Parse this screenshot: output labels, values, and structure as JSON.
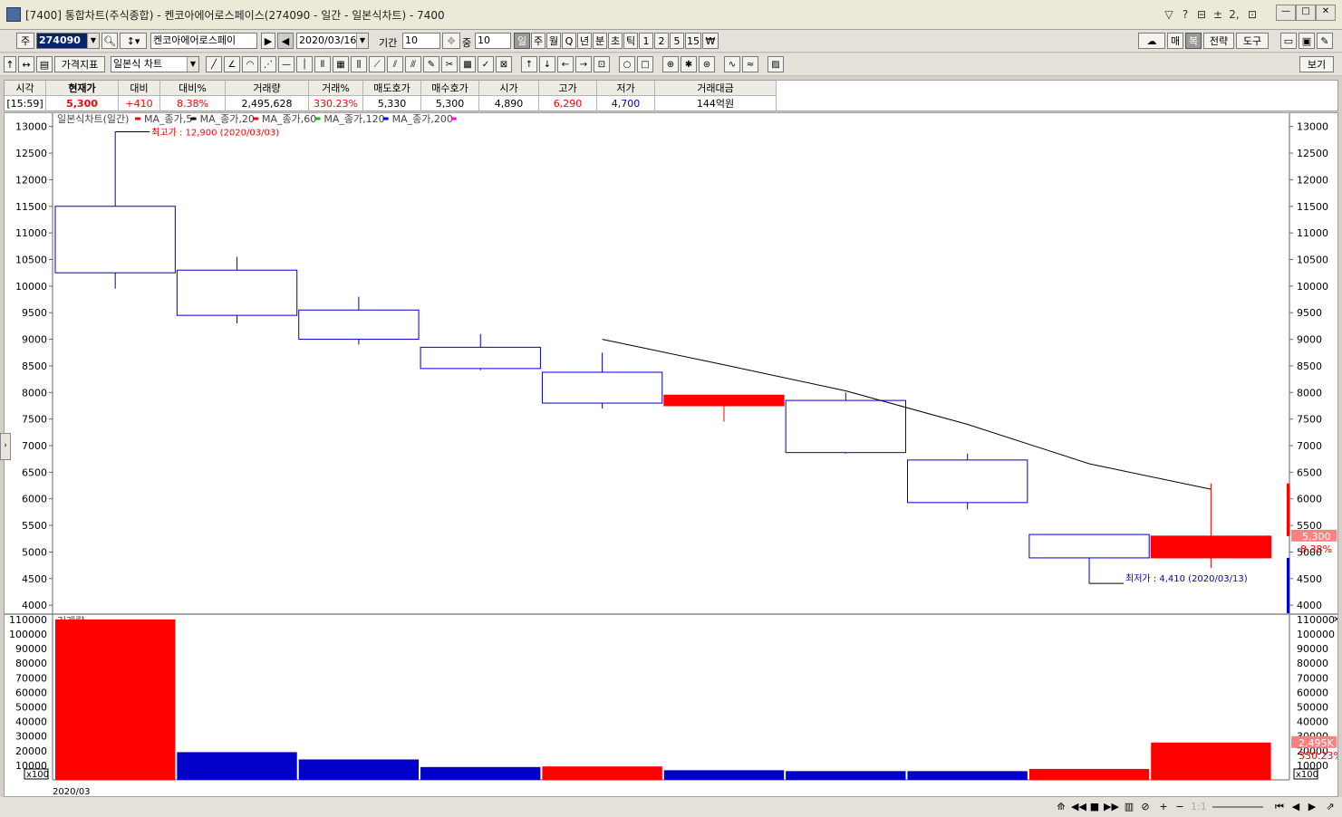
{
  "window": {
    "title": "[7400] 통합차트(주식종합) - 켄코아에어로스페이스(274090 - 일간 - 일본식차트) - 7400",
    "toolbar_icons": [
      "message-icon",
      "help-icon",
      "window-icon",
      "pin-icon",
      "dual-window-icon",
      "settings-icon"
    ],
    "help_label": "?",
    "dual_label": "2,"
  },
  "toolbar1": {
    "market_type": "주",
    "code": "274090",
    "stock_name": "켄코아에어로스페이",
    "date": "2020/03/16",
    "period_label": "기간",
    "period_value": "10",
    "overlap_label": "중",
    "overlap_value": "10",
    "timeframes": [
      "일",
      "주",
      "월",
      "Q",
      "년",
      "분",
      "초",
      "틱",
      "1",
      "2",
      "5",
      "15",
      "₩"
    ],
    "active_timeframe": 0,
    "right_buttons": [
      "매",
      "복",
      "전략",
      "도구"
    ]
  },
  "toolbar2": {
    "indicator_button": "가격지표",
    "chart_type": "일본식 차트",
    "view_button": "보기"
  },
  "quote": {
    "headers": [
      "시각",
      "현재가",
      "대비",
      "대비%",
      "거래량",
      "거래%",
      "매도호가",
      "매수호가",
      "시가",
      "고가",
      "저가",
      "거래대금"
    ],
    "values": [
      "[15:59]",
      "5,300",
      "+410",
      "8.38%",
      "2,495,628",
      "330.23%",
      "5,330",
      "5,300",
      "4,890",
      "6,290",
      "4,700",
      "144억원"
    ]
  },
  "chart_data": {
    "type": "candlestick",
    "legend": {
      "title": "일본식차트(일간)",
      "series": [
        {
          "name": "MA_종가,5",
          "color": "#ff0000"
        },
        {
          "name": "MA_종가,20",
          "color": "#000000"
        },
        {
          "name": "MA_종가,60",
          "color": "#ff0000"
        },
        {
          "name": "MA_종가,120",
          "color": "#00c000"
        },
        {
          "name": "MA_종가,200",
          "color": "#0000ff"
        }
      ],
      "end_color": "#ff00ff"
    },
    "price_axis": {
      "min": 4000,
      "max": 13000,
      "step": 500,
      "ylim": [
        3850,
        13250
      ]
    },
    "candles": [
      {
        "open": 11500,
        "high": 12900,
        "low": 9950,
        "close": 10250
      },
      {
        "open": 10300,
        "high": 10550,
        "low": 9300,
        "close": 9450
      },
      {
        "open": 9550,
        "high": 9800,
        "low": 8900,
        "close": 9000
      },
      {
        "open": 8850,
        "high": 9100,
        "low": 8420,
        "close": 8450
      },
      {
        "open": 8380,
        "high": 8750,
        "low": 7700,
        "close": 7800
      },
      {
        "open": 7750,
        "high": 7950,
        "low": 7450,
        "close": 7950
      },
      {
        "open": 7850,
        "high": 8000,
        "low": 6850,
        "close": 6870
      },
      {
        "open": 6730,
        "high": 6850,
        "low": 5800,
        "close": 5930
      },
      {
        "open": 5330,
        "high": 5330,
        "low": 4410,
        "close": 4890
      },
      {
        "open": 4890,
        "high": 6290,
        "low": 4700,
        "close": 5300
      }
    ],
    "ma5": [
      null,
      null,
      null,
      null,
      9000,
      8520,
      8030,
      7400,
      6660,
      6180
    ],
    "annotations": {
      "high": "최고가 : 12,900 (2020/03/03)",
      "low": "최저가 : 4,410 (2020/03/13)"
    },
    "last_price_label": "5,300",
    "last_change_label": "8.38%",
    "volume": {
      "title": "거래량",
      "axis_max": 110000,
      "step": 10000,
      "ylim": [
        0,
        113000
      ],
      "values": [
        110000,
        19000,
        14000,
        8800,
        9200,
        6600,
        6000,
        6000,
        7500,
        25600
      ],
      "up": [
        true,
        false,
        false,
        false,
        true,
        false,
        false,
        false,
        true,
        true
      ],
      "unit_label": "x100",
      "last_volume_label": "2,495K",
      "last_volume_pct": "330.23%"
    },
    "x_label": "2020/03",
    "colors": {
      "up": "#ff0000",
      "down": "#0000c8",
      "ma": "#000000"
    }
  }
}
